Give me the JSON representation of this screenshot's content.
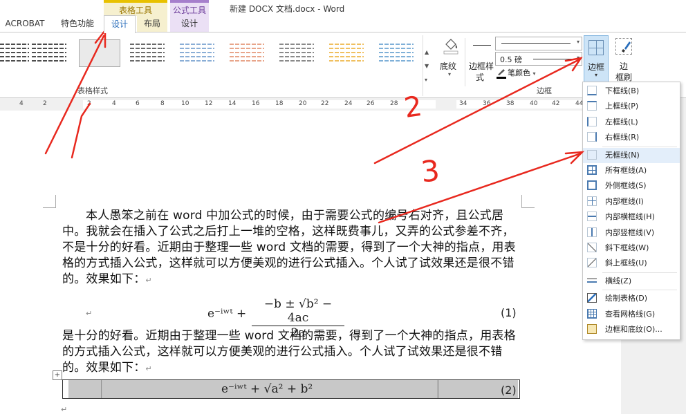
{
  "window": {
    "title": "新建 DOCX 文档.docx - Word",
    "context_tabs": {
      "table_tools": "表格工具",
      "formula_tools": "公式工具"
    }
  },
  "tabs": {
    "acrobat": "ACROBAT",
    "special": "特色功能",
    "design": "设计",
    "layout": "布局",
    "formula_design": "设计"
  },
  "ribbon": {
    "table_styles_label": "表格样式",
    "shading_label": "底纹",
    "border_styles_label1": "边框样",
    "border_styles_label2": "式",
    "line_weight": "0.5 磅",
    "pen_color": "笔颜色",
    "borders_label": "边框",
    "painter_label1": "边",
    "painter_label2": "框刷",
    "group_borders": "边框",
    "style_colors": [
      "#4d4d4d",
      "#4d4d4d",
      "#4d4d4d",
      "#6a6a6a",
      "#8aaed6",
      "#e8a58a",
      "#8a8a8a",
      "#f0c060",
      "#7fb0d8",
      "#8ec06a"
    ],
    "gallery_arrows": {
      "up": "▲",
      "down": "▼",
      "more": "▾"
    },
    "dropdown_arrow": "▾"
  },
  "ruler": {
    "numbers": [
      "4",
      "2",
      "2",
      "4",
      "6",
      "8",
      "10",
      "12",
      "14",
      "16",
      "18",
      "20",
      "22",
      "24",
      "26",
      "28",
      "34",
      "36",
      "38",
      "40",
      "42",
      "44"
    ]
  },
  "document": {
    "para1": "本人愚笨之前在 word 中加公式的时候，由于需要公式的编号右对齐，且公式居中。我就会在插入了公式之后打上一堆的空格，这样既费事儿，又弄的公式参差不齐，不是十分的好看。近期由于整理一些 word 文档的需要，得到了一个大神的指点，用表格的方式插入公式，这样就可以方便美观的进行公式插入。个人试了试效果还是很不错的。效果如下：",
    "para2": "是十分的好看。近期由于整理一些 word 文档的需要，得到了一个大神的指点，用表格的方式插入公式，这样就可以方便美观的进行公式插入。个人试了试效果还是很不错的。效果如下：",
    "eq1_lhs": "e⁻ⁱʷᵗ +",
    "eq1_num": "−b ± √b² − 4ac",
    "eq1_den": "2a",
    "eq1_number": "(1)",
    "eq2": "e⁻ⁱʷᵗ + √a² + b²",
    "eq2_number": "(2)",
    "para_mark": "↵",
    "table_handle": "+"
  },
  "border_menu": {
    "items": [
      {
        "label": "下框线(B)",
        "icon": "bottom-border-icon"
      },
      {
        "label": "上框线(P)",
        "icon": "top-border-icon"
      },
      {
        "label": "左框线(L)",
        "icon": "left-border-icon"
      },
      {
        "label": "右框线(R)",
        "icon": "right-border-icon"
      },
      {
        "label": "无框线(N)",
        "icon": "no-border-icon"
      },
      {
        "label": "所有框线(A)",
        "icon": "all-borders-icon"
      },
      {
        "label": "外侧框线(S)",
        "icon": "outside-borders-icon"
      },
      {
        "label": "内部框线(I)",
        "icon": "inside-borders-icon"
      },
      {
        "label": "内部横框线(H)",
        "icon": "inside-horizontal-border-icon"
      },
      {
        "label": "内部竖框线(V)",
        "icon": "inside-vertical-border-icon"
      },
      {
        "label": "斜下框线(W)",
        "icon": "diagonal-down-border-icon"
      },
      {
        "label": "斜上框线(U)",
        "icon": "diagonal-up-border-icon"
      },
      {
        "label": "横线(Z)",
        "icon": "horizontal-line-icon"
      },
      {
        "label": "绘制表格(D)",
        "icon": "draw-table-icon"
      },
      {
        "label": "查看网格线(G)",
        "icon": "view-gridlines-icon"
      },
      {
        "label": "边框和底纹(O)...",
        "icon": "borders-and-shading-icon"
      }
    ]
  },
  "annotations": {
    "label2": "2",
    "label3": "3",
    "color": "#e8281e"
  }
}
